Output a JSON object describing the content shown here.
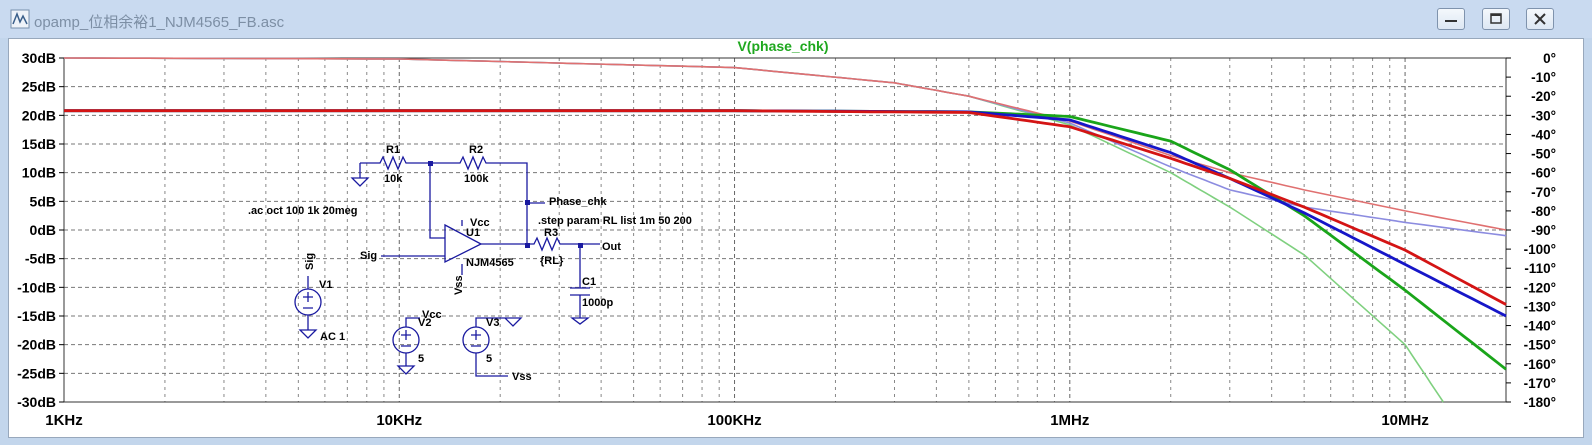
{
  "window": {
    "title": "opamp_位相余裕1_NJM4565_FB.asc",
    "buttons": [
      "minimize",
      "maximize",
      "close"
    ]
  },
  "plot": {
    "trace_title": "V(phase_chk)",
    "trace_title_color": "#1fa81f"
  },
  "schematic": {
    "r1_name": "R1",
    "r1_value": "10k",
    "r2_name": "R2",
    "r2_value": "100k",
    "r3_name": "R3",
    "r3_value": "{RL}",
    "c1_name": "C1",
    "c1_value": "1000p",
    "u1_name": "U1",
    "u1_part": "NJM4565",
    "u1_vcc": "Vcc",
    "u1_vss": "Vss",
    "v1_name": "V1",
    "v1_value": "AC 1",
    "v2_name": "V2",
    "v2_value": "5",
    "v3_name": "V3",
    "v3_value": "5",
    "vcc_label": "Vcc",
    "vss_label": "Vss",
    "sig_label": "Sig",
    "sig_label2": "Sig",
    "out_label": "Out",
    "phase_label": "Phase_chk",
    "ac_directive": ".ac oct 100 1k 20meg",
    "step_directive": ".step param RL list 1m 50 200"
  },
  "chart_data": {
    "type": "line",
    "x_scale": "log",
    "xlim": [
      1000,
      20000000
    ],
    "xticks": [
      "1KHz",
      "10KHz",
      "100KHz",
      "1MHz",
      "10MHz"
    ],
    "ylim_left": [
      -30,
      30
    ],
    "yticks_left": [
      "30dB",
      "25dB",
      "20dB",
      "15dB",
      "10dB",
      "5dB",
      "0dB",
      "-5dB",
      "-10dB",
      "-15dB",
      "-20dB",
      "-25dB",
      "-30dB"
    ],
    "ylim_right": [
      -180,
      0
    ],
    "yticks_right": [
      "0°",
      "-10°",
      "-20°",
      "-30°",
      "-40°",
      "-50°",
      "-60°",
      "-70°",
      "-80°",
      "-90°",
      "-100°",
      "-110°",
      "-120°",
      "-130°",
      "-140°",
      "-150°",
      "-160°",
      "-170°",
      "-180°"
    ],
    "grid": true,
    "series": [
      {
        "color": "#1aa51a",
        "style": "magnitude",
        "x": [
          1000,
          100000,
          500000,
          1000000,
          2000000,
          3000000,
          5000000,
          10000000,
          20000000
        ],
        "y": [
          20.8,
          20.8,
          20.6,
          19.8,
          15.5,
          10.5,
          2.5,
          -10.5,
          -24.3
        ]
      },
      {
        "color": "#1616c8",
        "style": "magnitude",
        "x": [
          1000,
          100000,
          500000,
          1000000,
          2000000,
          3000000,
          5000000,
          10000000,
          20000000
        ],
        "y": [
          20.8,
          20.8,
          20.6,
          19.2,
          13.5,
          9.0,
          3.0,
          -6.0,
          -15.0
        ]
      },
      {
        "color": "#d41414",
        "style": "magnitude",
        "x": [
          1000,
          100000,
          500000,
          1000000,
          2000000,
          3000000,
          5000000,
          10000000,
          20000000
        ],
        "y": [
          20.8,
          20.8,
          20.5,
          18.0,
          12.5,
          9.0,
          4.0,
          -3.5,
          -13.0
        ]
      },
      {
        "color": "#7fd07f",
        "style": "phase",
        "x": [
          1000,
          10000,
          100000,
          300000,
          500000,
          1000000,
          2000000,
          3000000,
          5000000,
          10000000,
          13000000
        ],
        "y": [
          0,
          -0.5,
          -5,
          -13,
          -20,
          -35,
          -60,
          -78,
          -103,
          -150,
          -180
        ]
      },
      {
        "color": "#8c8ce0",
        "style": "phase",
        "x": [
          1000,
          10000,
          100000,
          300000,
          500000,
          1000000,
          2000000,
          3000000,
          5000000,
          10000000,
          20000000
        ],
        "y": [
          0,
          -0.5,
          -5,
          -13,
          -20,
          -34,
          -57,
          -69,
          -78,
          -86,
          -93
        ]
      },
      {
        "color": "#e07070",
        "style": "phase",
        "x": [
          1000,
          10000,
          100000,
          300000,
          500000,
          1000000,
          2000000,
          3000000,
          5000000,
          10000000,
          20000000
        ],
        "y": [
          0,
          -0.5,
          -5,
          -13,
          -20,
          -33,
          -51,
          -60,
          -69,
          -80,
          -90
        ]
      }
    ]
  }
}
